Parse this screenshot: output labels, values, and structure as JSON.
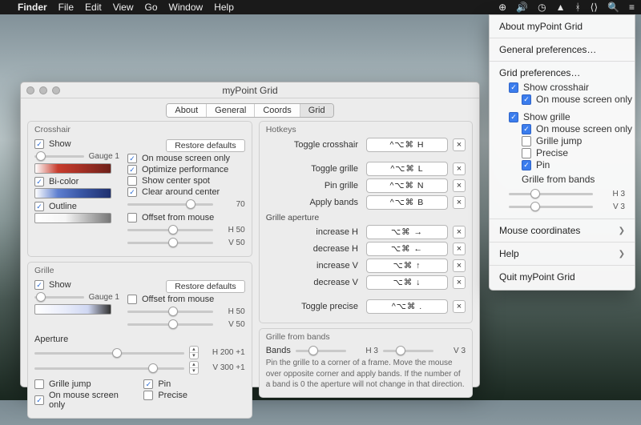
{
  "menubar": {
    "app": "Finder",
    "items": [
      "File",
      "Edit",
      "View",
      "Go",
      "Window",
      "Help"
    ]
  },
  "window": {
    "title": "myPoint Grid",
    "tabs": [
      "About",
      "General",
      "Coords",
      "Grid"
    ],
    "active_tab": 3
  },
  "crosshair": {
    "title": "Crosshair",
    "show": "Show",
    "gauge": "Gauge 1",
    "bicolor": "Bi-color",
    "outline": "Outline",
    "restore": "Restore defaults",
    "on_mouse": "On mouse screen only",
    "optimize": "Optimize performance",
    "center_spot": "Show center spot",
    "clear_center": "Clear around center",
    "clear_val": "70",
    "offset": "Offset from mouse",
    "h": "H 50",
    "v": "V 50"
  },
  "grille": {
    "title": "Grille",
    "show": "Show",
    "gauge": "Gauge 1",
    "restore": "Restore defaults",
    "offset": "Offset from mouse",
    "h": "H 50",
    "v": "V 50",
    "aperture": "Aperture",
    "ah": "H 200 +1",
    "av": "V 300 +1",
    "jump": "Grille jump",
    "on_mouse": "On mouse screen only",
    "pin": "Pin",
    "precise": "Precise"
  },
  "hotkeys": {
    "title": "Hotkeys",
    "items": [
      {
        "name": "Toggle crosshair",
        "key": "^⌥⌘ H"
      },
      {
        "name": "Toggle grille",
        "key": "^⌥⌘ L"
      },
      {
        "name": "Pin grille",
        "key": "^⌥⌘ N"
      },
      {
        "name": "Apply bands",
        "key": "^⌥⌘ B"
      }
    ],
    "aperture_title": "Grille aperture",
    "ap_items": [
      {
        "name": "increase H",
        "key": "⌥⌘ →"
      },
      {
        "name": "decrease H",
        "key": "⌥⌘ ←"
      },
      {
        "name": "increase V",
        "key": "⌥⌘ ↑"
      },
      {
        "name": "decrease V",
        "key": "⌥⌘ ↓"
      }
    ],
    "toggle_precise": {
      "name": "Toggle precise",
      "key": "^⌥⌘ ."
    },
    "clear": "×"
  },
  "bands": {
    "title": "Grille from bands",
    "label": "Bands",
    "h": "H 3",
    "v": "V 3",
    "hint": "Pin the grille to a corner of a frame. Move the mouse over opposite corner and apply bands. If the number of a band is 0 the aperture will not change in that direction."
  },
  "menu": {
    "about": "About myPoint Grid",
    "general": "General preferences…",
    "gridprefs": "Grid preferences…",
    "show_crosshair": "Show crosshair",
    "on_mouse": "On mouse screen only",
    "show_grille": "Show grille",
    "grille_jump": "Grille jump",
    "precise": "Precise",
    "pin": "Pin",
    "bands_title": "Grille from bands",
    "h": "H 3",
    "v": "V 3",
    "coords": "Mouse coordinates",
    "help": "Help",
    "quit": "Quit myPoint Grid"
  }
}
